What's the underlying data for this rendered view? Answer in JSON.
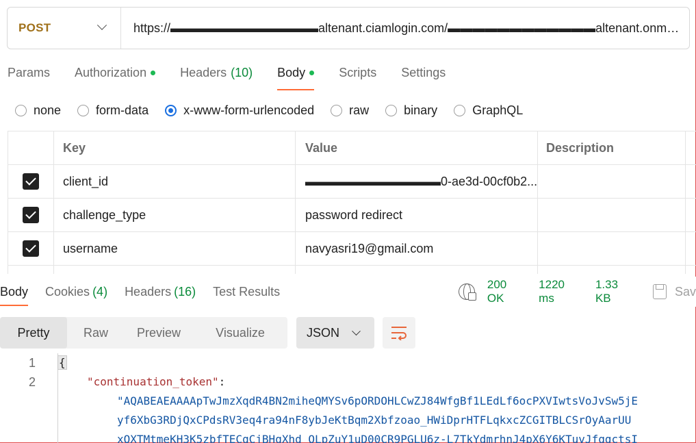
{
  "request": {
    "method": "POST",
    "url": "https://▬▬▬▬▬▬▬▬▬▬▬▬altenant.ciamlogin.com/▬▬▬▬▬▬▬▬▬▬▬▬altenant.onmicrosoft.co..."
  },
  "req_tabs": [
    {
      "label": "Params",
      "count": "",
      "dot": false
    },
    {
      "label": "Authorization",
      "count": "",
      "dot": true
    },
    {
      "label": "Headers",
      "count": "(10)",
      "dot": false
    },
    {
      "label": "Body",
      "count": "",
      "dot": true,
      "active": true
    },
    {
      "label": "Scripts",
      "count": "",
      "dot": false
    },
    {
      "label": "Settings",
      "count": "",
      "dot": false
    }
  ],
  "body_types": [
    {
      "label": "none",
      "checked": false
    },
    {
      "label": "form-data",
      "checked": false
    },
    {
      "label": "x-www-form-urlencoded",
      "checked": true
    },
    {
      "label": "raw",
      "checked": false
    },
    {
      "label": "binary",
      "checked": false
    },
    {
      "label": "GraphQL",
      "checked": false
    }
  ],
  "params_table": {
    "headers": [
      "Key",
      "Value",
      "Description"
    ],
    "rows": [
      {
        "key": "client_id",
        "value": "▬▬▬▬▬▬▬▬▬▬▬0-ae3d-00cf0b2...",
        "checked": true
      },
      {
        "key": "challenge_type",
        "value": "password redirect",
        "checked": true
      },
      {
        "key": "username",
        "value": "navyasri19@gmail.com",
        "checked": true
      }
    ]
  },
  "response": {
    "tabs": [
      {
        "label": "Body",
        "count": "",
        "active": true
      },
      {
        "label": "Cookies",
        "count": "(4)"
      },
      {
        "label": "Headers",
        "count": "(16)"
      },
      {
        "label": "Test Results",
        "count": ""
      }
    ],
    "status": "200 OK",
    "time": "1220 ms",
    "size": "1.33 KB",
    "save_label": "Sav"
  },
  "view_modes": [
    "Pretty",
    "Raw",
    "Preview",
    "Visualize"
  ],
  "active_view": "Pretty",
  "format": "JSON",
  "code": {
    "line_numbers": [
      "1",
      "2"
    ],
    "open_brace": "{",
    "key": "\"continuation_token\"",
    "colon": ":",
    "value_lines": [
      "\"AQABEAEAAAApTwJmzXqdR4BN2miheQMYSv6pORDOHLCwZJ84WfgBf1LEdLf6ocPXVIwtsVoJvSw5jE",
      "yf6XbG3RDjQxCPdsRV3eq4ra94nF8ybJeKtBqm2Xbfzoao_HWiDprHTFLqkxcZCGITBLCSrOyAarUU",
      "xQXTMtmeKH3K5zbfTECqCjBHgXhd_OLpZuY1uD00CR9PGLU6z-L7TkYdmrhnJ4pX6Y6KTuvJfqgctsI"
    ]
  },
  "colors": {
    "method": "#a0711b",
    "accent": "#ff6c37",
    "success": "#0a8a3a",
    "radio": "#1a6fe0"
  }
}
